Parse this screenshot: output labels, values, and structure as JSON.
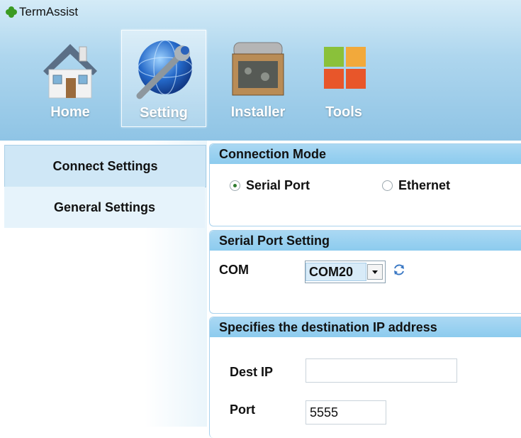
{
  "app": {
    "title": "TermAssist"
  },
  "toolbar": {
    "items": [
      {
        "label": "Home",
        "icon": "house-icon",
        "active": false
      },
      {
        "label": "Setting",
        "icon": "globe-wrench-icon",
        "active": true
      },
      {
        "label": "Installer",
        "icon": "installer-box-icon",
        "active": false
      },
      {
        "label": "Tools",
        "icon": "tiles-icon",
        "active": false
      }
    ]
  },
  "sidebar": {
    "items": [
      {
        "label": "Connect Settings",
        "selected": true
      },
      {
        "label": "General Settings",
        "selected": false
      }
    ]
  },
  "connection_mode": {
    "title": "Connection Mode",
    "options": [
      {
        "label": "Serial Port",
        "checked": true
      },
      {
        "label": "Ethernet",
        "checked": false
      }
    ]
  },
  "serial": {
    "title": "Serial Port Setting",
    "com_label": "COM",
    "com_value": "COM20"
  },
  "destination": {
    "title": "Specifies the destination IP address",
    "ip_label": "Dest IP",
    "ip_value": "",
    "port_label": "Port",
    "port_value": "5555"
  },
  "colors": {
    "header": "#8fc4e5",
    "group_header": "#9dd3f1",
    "sidebar_selected": "#cfe7f6"
  }
}
